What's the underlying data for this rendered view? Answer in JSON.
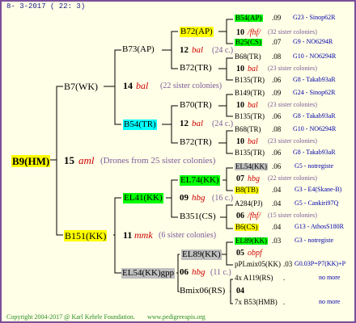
{
  "header": {
    "date": "8- 3-2017 ( 22: 3)"
  },
  "colors": {
    "border": "#7a4f9a",
    "background": "#fffee6",
    "yellow": "#ffff00",
    "green": "#00ff00",
    "cyan": "#00ffff",
    "gray": "#bfbfbf",
    "italic_red": "#cc0000",
    "sister": "#7a5a9a",
    "link": "#0000aa",
    "footer": "#2b8f2b"
  },
  "root": {
    "label": "B9(HM)",
    "num": "15",
    "type": "aml",
    "note": "(Drones from 25 sister colonies)"
  },
  "gen1": {
    "upper": {
      "label": "B7(WK)",
      "num": "14",
      "type": "bal",
      "note": "(22 sister colonies)"
    },
    "lower": {
      "label": "B151(KK)",
      "num": "11",
      "type": "mmk",
      "note": "(6 sister colonies)"
    }
  },
  "gen2": {
    "b73": {
      "label": "B73(AP)"
    },
    "b54": {
      "label": "B54(TR)"
    },
    "el41": {
      "label": "EL41(KK)"
    },
    "el54": {
      "label": "EL54(KK)gpp"
    }
  },
  "gen3": {
    "b72a": {
      "label": "B72(AP)",
      "num": "12",
      "type": "bal",
      "note": "(24 c.)"
    },
    "b72tr": {
      "label": "B72(TR)"
    },
    "b70": {
      "label": "B70(TR)",
      "num": "12",
      "type": "bal",
      "note": "(24 c.)"
    },
    "b72tr2": {
      "label": "B72(TR)"
    },
    "el74": {
      "label": "EL74(KK)",
      "num": "09",
      "type": "hbg",
      "note": "(16 c.)"
    },
    "b351": {
      "label": "B351(CS)"
    },
    "el89": {
      "label": "EL89(KK)",
      "num": "06",
      "type": "hbg",
      "note": "(11 c.)"
    },
    "bmix": {
      "label": "Bmix06(RS)"
    }
  },
  "gen4": [
    {
      "name": "B54(AP)",
      "val": ".09",
      "code": "G23 - Sinop62R",
      "hl": "green"
    },
    {
      "num": "10",
      "type": "/fhf/",
      "note": "(32 sister colonies)"
    },
    {
      "name": "B25(CS)",
      "val": ".07",
      "code": "G9 - NO6294R",
      "hl": "green"
    },
    {
      "name": "B68(TR)",
      "val": ".08",
      "code": "G10 - NO6294R",
      "hl": ""
    },
    {
      "num": "10",
      "type": "bal",
      "note": "(23 sister colonies)"
    },
    {
      "name": "B135(TR)",
      "val": ".06",
      "code": "G8 - Takab93aR",
      "hl": ""
    },
    {
      "name": "B149(TR)",
      "val": ".09",
      "code": "G24 - Sinop62R",
      "hl": ""
    },
    {
      "num": "10",
      "type": "bal",
      "note": "(23 sister colonies)"
    },
    {
      "name": "B135(TR)",
      "val": ".06",
      "code": "G8 - Takab93aR",
      "hl": ""
    },
    {
      "name": "B68(TR)",
      "val": ".08",
      "code": "G10 - NO6294R",
      "hl": ""
    },
    {
      "num": "10",
      "type": "bal",
      "note": "(23 sister colonies)"
    },
    {
      "name": "B135(TR)",
      "val": ".06",
      "code": "G8 - Takab93aR",
      "hl": ""
    },
    {
      "name": "EL54(KK)",
      "val": ".06",
      "code": "G5 - notregiste",
      "hl": "gray"
    },
    {
      "num": "07",
      "type": "hbg",
      "note": "(22 sister colonies)"
    },
    {
      "name": "B8(TB)",
      "val": ".04",
      "code": "G3 - E4(Skane-B)",
      "hl": "yellow"
    },
    {
      "name": "A284(PJ)",
      "val": ".04",
      "code": "G5 - Cankiri97Q",
      "hl": ""
    },
    {
      "num": "06",
      "type": "/fhf/",
      "note": "(15 sister colonies)"
    },
    {
      "name": "B6(CS)",
      "val": ".04",
      "code": "G13 - AthosS180R",
      "hl": "yellow"
    },
    {
      "name": "EL89(KK)",
      "val": ".03",
      "code": "G3 - notregiste",
      "hl": "green"
    },
    {
      "num": "05",
      "type": "obpf",
      "note": ""
    },
    {
      "name": "pPLmix05(KK)",
      "val": ".03",
      "code": "G0.03P=P7(KK)+P",
      "hl": ""
    },
    {
      "name": "4x A119(RS)",
      "val": ".",
      "code": "no more",
      "hl": ""
    },
    {
      "num": "04",
      "type": "",
      "note": ""
    },
    {
      "name": "7x B53(HMB)",
      "val": ".",
      "code": "no more",
      "hl": ""
    }
  ],
  "footer": {
    "copyright": "Copyright 2004-2017 @ Karl Kehrle Foundation.",
    "url": "www.pedigreeapis.org"
  }
}
